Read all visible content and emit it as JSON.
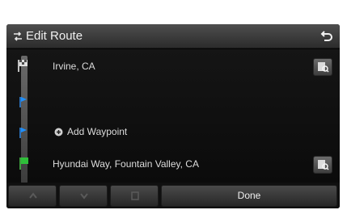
{
  "header": {
    "title": "Edit Route",
    "title_icon": "edit-route-icon",
    "back_icon": "back-arrow-icon"
  },
  "route": {
    "start": {
      "label": "Irvine, CA",
      "icon": "start-flag-icon"
    },
    "waypoint_slot": {
      "icon": "waypoint-marker-icon"
    },
    "add_waypoint": {
      "label": "Add Waypoint",
      "icon": "add-waypoint-icon"
    },
    "destination": {
      "label": "Hyundai Way, Fountain Valley, CA",
      "icon": "destination-flag-icon"
    },
    "search_icon": "map-search-icon"
  },
  "toolbar": {
    "move_up_icon": "move-up-icon",
    "move_down_icon": "move-down-icon",
    "delete_icon": "delete-icon",
    "done_label": "Done"
  },
  "colors": {
    "background": "#050505",
    "titlebar": "#3c3c3c",
    "accent_blue": "#1e90ff",
    "accent_green": "#2fbf3a"
  }
}
